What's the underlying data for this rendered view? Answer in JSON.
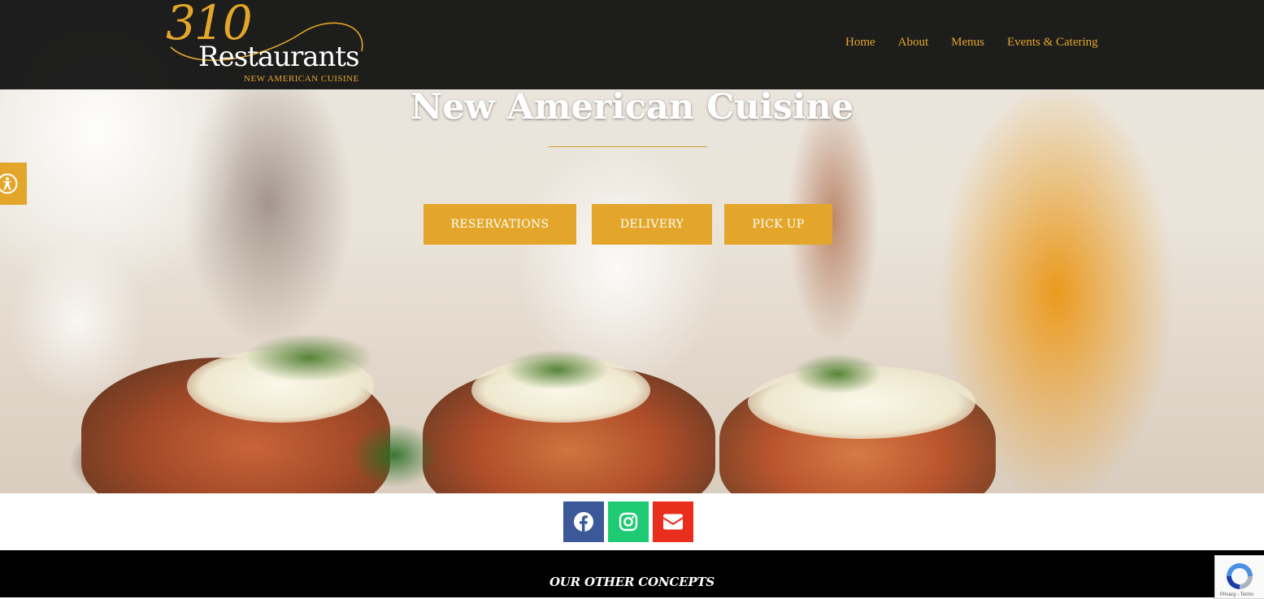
{
  "header": {
    "logo": {
      "number": "310",
      "name": "Restaurants",
      "tagline": "NEW AMERICAN CUISINE"
    },
    "nav": [
      {
        "label": "Home"
      },
      {
        "label": "About"
      },
      {
        "label": "Menus"
      },
      {
        "label": "Events & Catering"
      }
    ]
  },
  "hero": {
    "title": "New American Cuisine",
    "buttons": {
      "reservations": "RESERVATIONS",
      "delivery": "DELIVERY",
      "pickup": "PICK UP"
    }
  },
  "accessibility": {
    "icon": "accessibility-icon"
  },
  "social": {
    "facebook": {
      "icon": "facebook-icon",
      "color": "#3b5998"
    },
    "instagram": {
      "icon": "instagram-icon",
      "color": "#1ecb73"
    },
    "email": {
      "icon": "envelope-icon",
      "color": "#ea2e1e"
    }
  },
  "footer": {
    "title": "OUR OTHER CONCEPTS"
  },
  "recaptcha": {
    "terms_text": "Privacy - Terms"
  },
  "colors": {
    "accent": "#e3a62a",
    "header_bg": "#101010",
    "footer_bg": "#000000"
  }
}
